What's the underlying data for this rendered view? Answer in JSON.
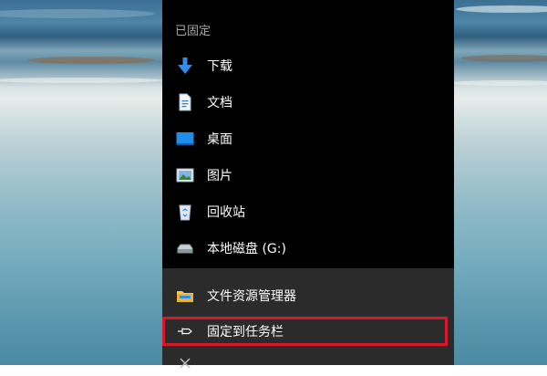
{
  "menu": {
    "section_header": "已固定",
    "pinned_items": [
      {
        "label": "下载",
        "icon": "download-arrow-icon"
      },
      {
        "label": "文档",
        "icon": "document-icon"
      },
      {
        "label": "桌面",
        "icon": "desktop-icon"
      },
      {
        "label": "图片",
        "icon": "pictures-icon"
      },
      {
        "label": "回收站",
        "icon": "recycle-bin-icon"
      },
      {
        "label": "本地磁盘 (G:)",
        "icon": "local-disk-icon"
      }
    ],
    "actions": [
      {
        "label": "文件资源管理器",
        "icon": "file-explorer-icon"
      },
      {
        "label": "固定到任务栏",
        "icon": "pin-icon",
        "highlighted": true
      }
    ]
  },
  "colors": {
    "menu_background": "#000000",
    "actions_background": "#2b2b2b",
    "highlight_border": "#d6192a",
    "accent_blue": "#1e90ff"
  }
}
